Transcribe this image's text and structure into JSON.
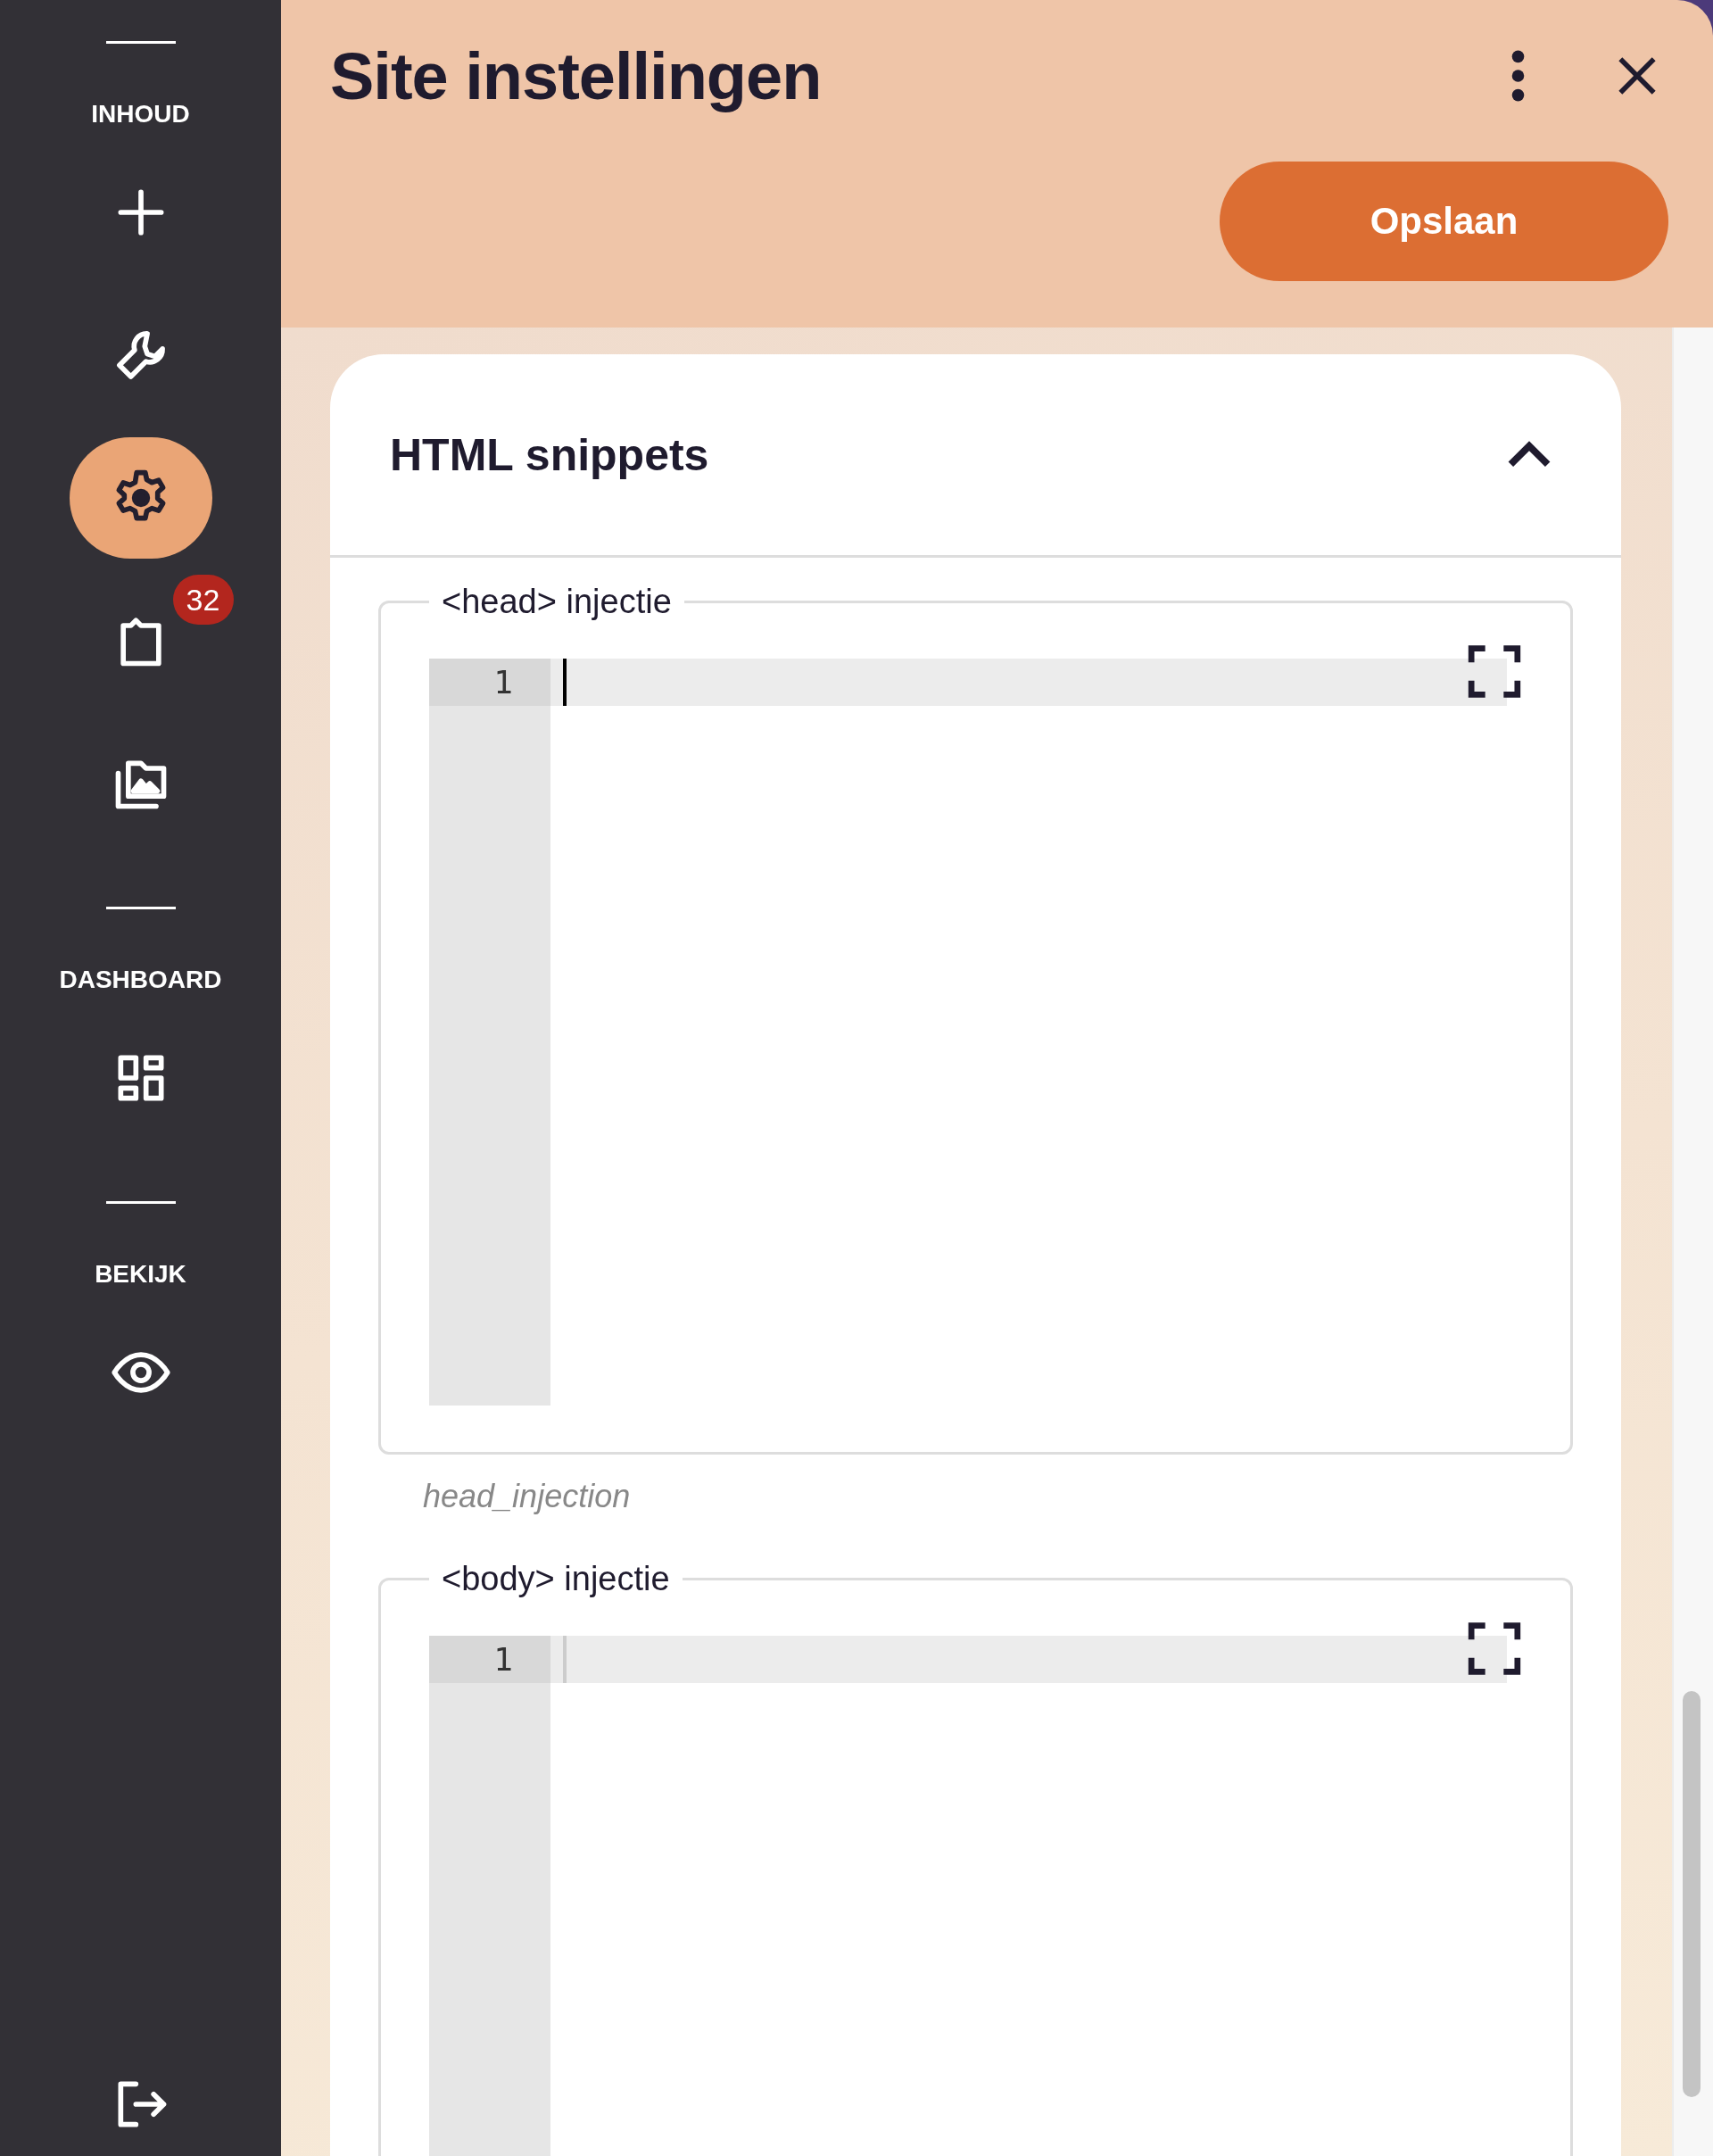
{
  "sidebar": {
    "sections": [
      {
        "label": "INHOUD",
        "items": [
          {
            "kind": "plus",
            "selected": false
          },
          {
            "kind": "wrench",
            "selected": false
          },
          {
            "kind": "gear",
            "selected": true
          },
          {
            "kind": "clipboard",
            "selected": false,
            "badge": "32"
          },
          {
            "kind": "gallery",
            "selected": false
          }
        ]
      },
      {
        "label": "DASHBOARD",
        "items": [
          {
            "kind": "dashboard",
            "selected": false
          }
        ]
      },
      {
        "label": "BEKIJK",
        "items": [
          {
            "kind": "eye",
            "selected": false
          }
        ]
      }
    ],
    "footer_item": {
      "kind": "logout"
    }
  },
  "header": {
    "title": "Site instellingen",
    "save_button": "Opslaan"
  },
  "card": {
    "title": "HTML snippets",
    "expanded": true,
    "fields": [
      {
        "label": "<head> injectie",
        "line_numbers": [
          "1"
        ],
        "focused": true,
        "hint": "head_injection"
      },
      {
        "label": "<body> injectie",
        "line_numbers": [
          "1"
        ],
        "focused": false
      }
    ]
  }
}
